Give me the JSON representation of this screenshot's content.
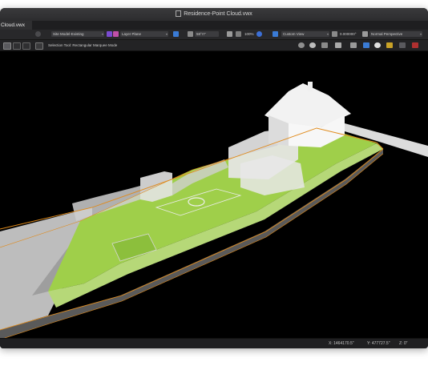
{
  "window": {
    "title": "Residence-Point Cloud.vwx"
  },
  "tabs": [
    {
      "label": "Cloud.vwx"
    }
  ],
  "toolbar": {
    "layer_dropdown": "Site Model-Existing",
    "plane_dropdown": "Layer Plane",
    "rotation_value": "58°r7'",
    "zoom_value": "100%",
    "view_dropdown": "Custom View",
    "angle_value": "0.000000°",
    "render_dropdown": "Normal Perspective"
  },
  "mode_bar": {
    "mode_text": "Selection Tool: Rectangular Marquee Mode"
  },
  "icons": {
    "titlebar": "document-icon",
    "toolbar": [
      "eye-icon",
      "layer-icon",
      "class-icon",
      "plane-icon",
      "ruler-icon",
      "rotate-icon",
      "zoom-icon",
      "view-icon",
      "flyover-icon",
      "render-icon",
      "color-icon",
      "light-icon"
    ],
    "mode_bar": [
      "select-mode-icon",
      "lasso-icon",
      "marquee-icon",
      "snap-icon",
      "gear-icon",
      "walkthrough-icon",
      "visibility-icon",
      "flip-icon",
      "perspective-icon",
      "clip-cube-icon",
      "render-mode-icon",
      "lighting-icon"
    ]
  },
  "status": {
    "x": "X: 1464170.5\"",
    "y": "Y: 477727.5\"",
    "z": "Z: 0\""
  },
  "colors": {
    "viewport_bg": "#000000",
    "lawn": "#9fcf4a",
    "boundary": "#e08a1a",
    "model_white": "#eaeaea"
  }
}
